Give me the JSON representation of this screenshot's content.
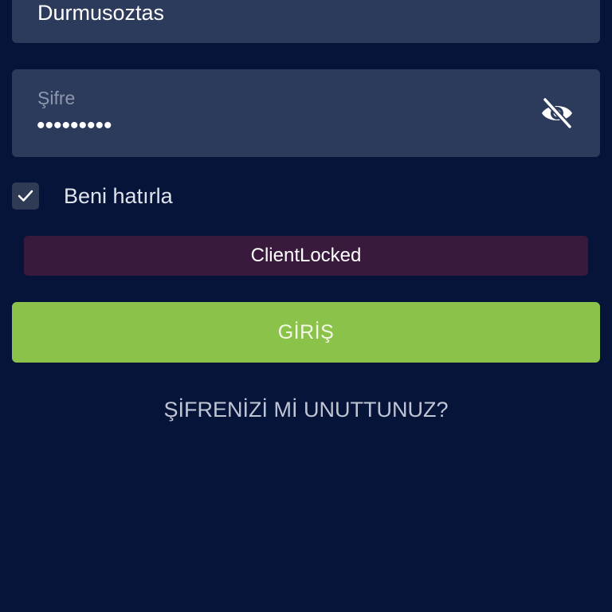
{
  "login_form": {
    "username": {
      "value": "Durmusoztas"
    },
    "password": {
      "label": "Şifre",
      "masked_value": "•••••••••",
      "visibility_icon": "eye-off-icon"
    },
    "remember_me": {
      "label": "Beni hatırla",
      "checked": true,
      "icon": "check-icon"
    },
    "error_message": "ClientLocked",
    "login_button_label": "GİRİŞ",
    "forgot_password_label": "ŞİFRENİZİ Mİ UNUTTUNUZ?"
  },
  "colors": {
    "background": "#06143a",
    "field_background": "#2c3a5c",
    "error_background": "#3a1a3c",
    "primary_button": "#8bc34a"
  }
}
